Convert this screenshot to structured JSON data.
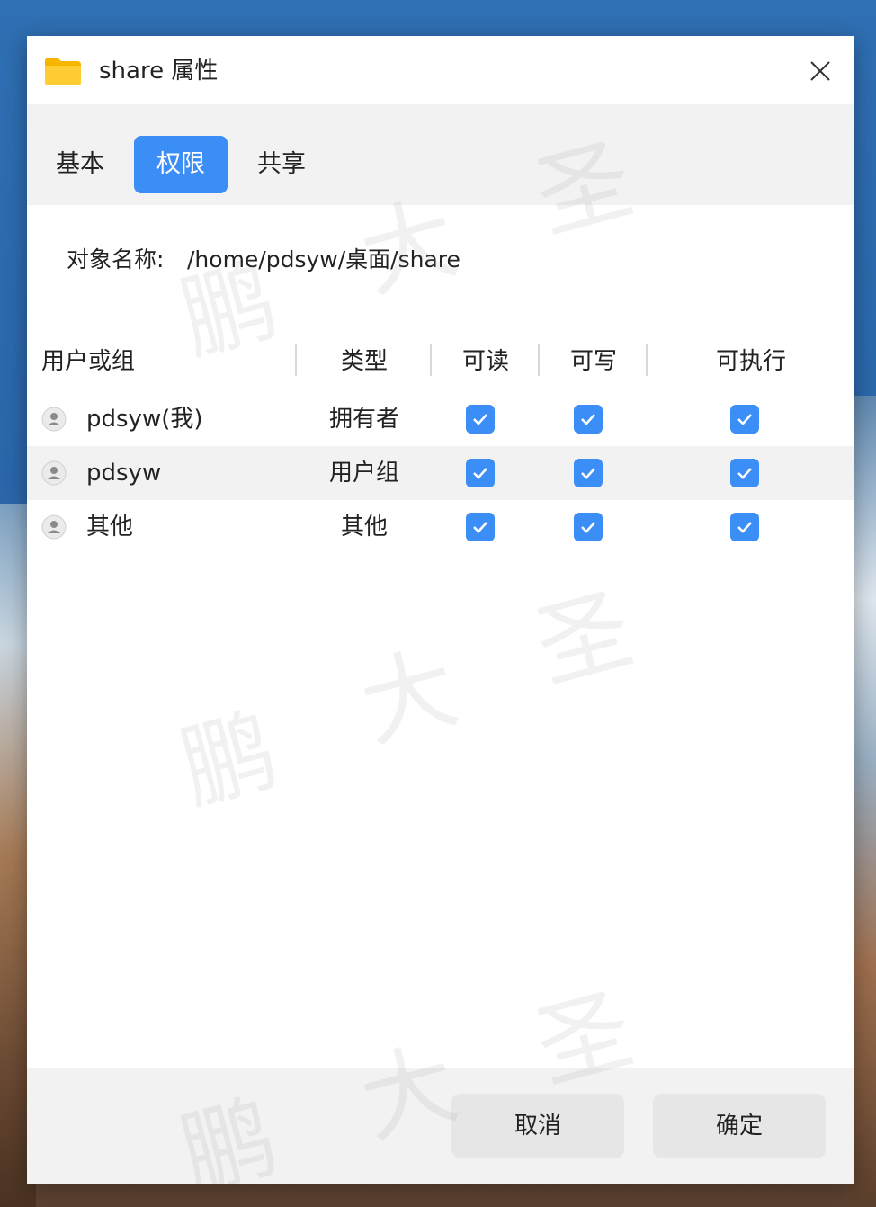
{
  "dialog": {
    "title": "share 属性",
    "folder_icon": "folder-icon",
    "close_icon": "close-icon"
  },
  "tabs": [
    {
      "label": "基本",
      "active": false
    },
    {
      "label": "权限",
      "active": true
    },
    {
      "label": "共享",
      "active": false
    }
  ],
  "object": {
    "label": "对象名称:",
    "path": "/home/pdsyw/桌面/share"
  },
  "table": {
    "headers": [
      "用户或组",
      "类型",
      "可读",
      "可写",
      "可执行"
    ],
    "rows": [
      {
        "name": "pdsyw(我)",
        "type": "拥有者",
        "read": true,
        "write": true,
        "execute": true
      },
      {
        "name": "pdsyw",
        "type": "用户组",
        "read": true,
        "write": true,
        "execute": true
      },
      {
        "name": "其他",
        "type": "其他",
        "read": true,
        "write": true,
        "execute": true
      }
    ]
  },
  "buttons": {
    "cancel": "取消",
    "ok": "确定"
  },
  "watermark": {
    "chars": [
      "鹏",
      "大",
      "圣"
    ]
  },
  "colors": {
    "accent": "#3b8ef5",
    "panel": "#f2f2f2"
  }
}
